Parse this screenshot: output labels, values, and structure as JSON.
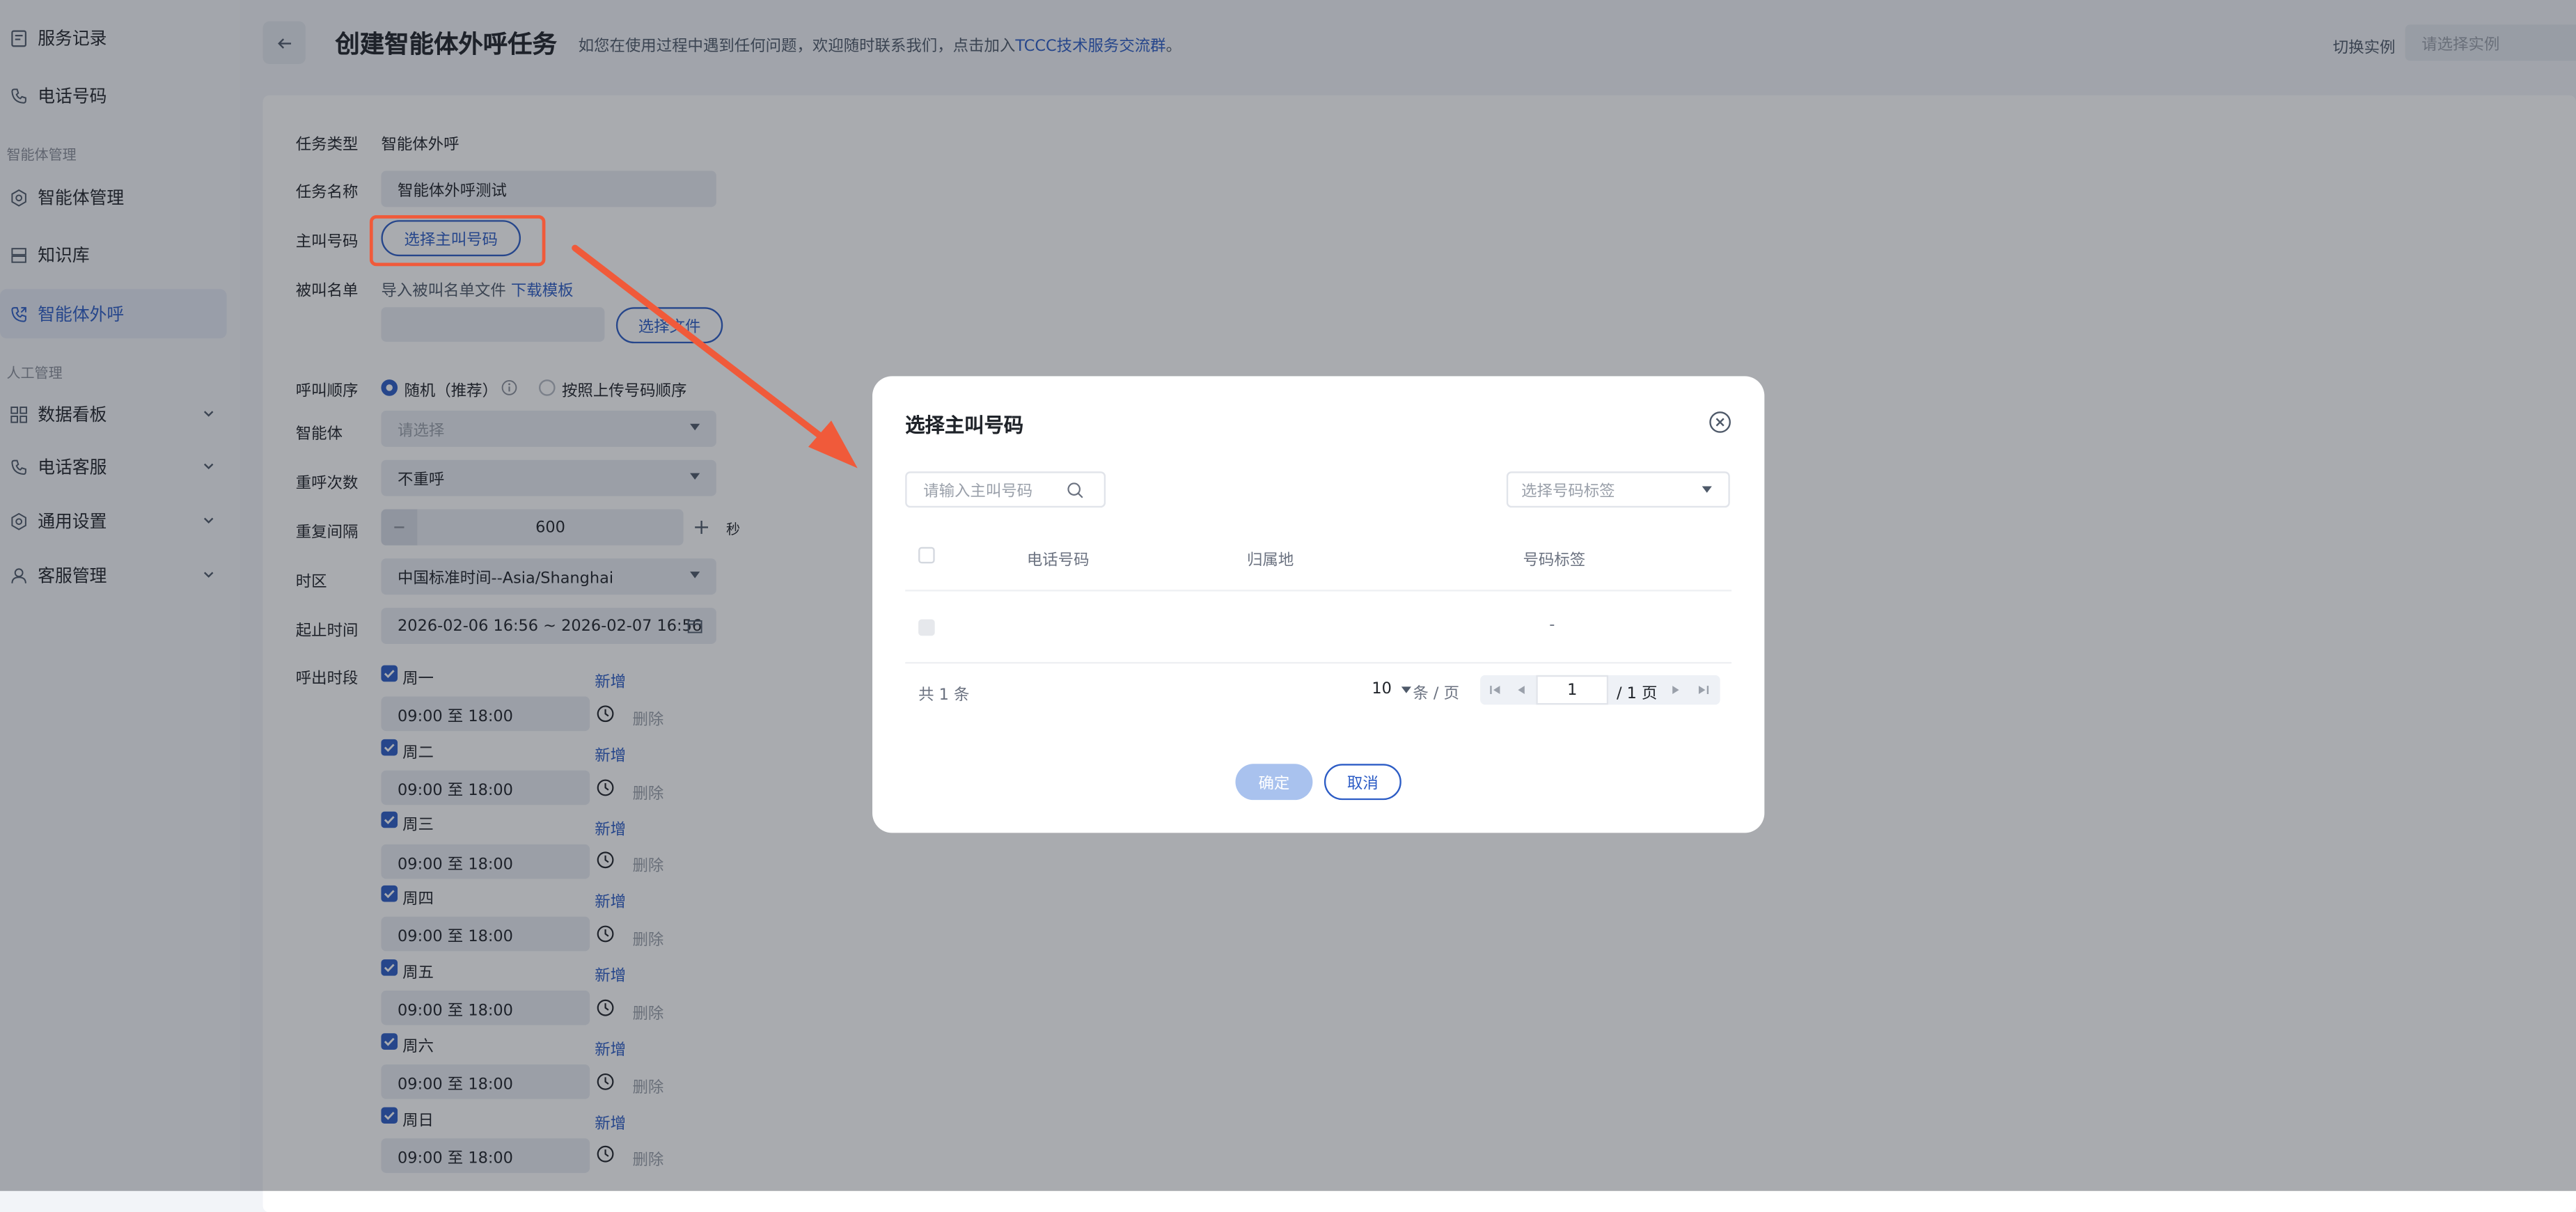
{
  "sidebar": {
    "items_top": [
      {
        "label": "服务记录",
        "icon": "document-icon"
      },
      {
        "label": "电话号码",
        "icon": "phone-icon"
      }
    ],
    "section_agents": "智能体管理",
    "items_agents": [
      {
        "label": "智能体管理",
        "icon": "gear-icon"
      },
      {
        "label": "知识库",
        "icon": "database-icon"
      },
      {
        "label": "智能体外呼",
        "icon": "phone-outbound-icon",
        "active": true
      }
    ],
    "section_human": "人工管理",
    "items_human": [
      {
        "label": "数据看板",
        "icon": "grid-icon"
      },
      {
        "label": "电话客服",
        "icon": "phone-icon"
      },
      {
        "label": "通用设置",
        "icon": "gear-icon"
      },
      {
        "label": "客服管理",
        "icon": "user-icon"
      }
    ]
  },
  "header": {
    "title": "创建智能体外呼任务",
    "desc_prefix": "如您在使用过程中遇到任何问题，欢迎随时联系我们，点击加入",
    "desc_link": "TCCC技术服务交流群",
    "desc_suffix": "。",
    "switch_label": "切换实例",
    "switch_placeholder": "请选择实例"
  },
  "form": {
    "task_type_label": "任务类型",
    "task_type_value": "智能体外呼",
    "task_name_label": "任务名称",
    "task_name_value": "智能体外呼测试",
    "caller_label": "主叫号码",
    "caller_button": "选择主叫号码",
    "callee_label": "被叫名单",
    "callee_hint": "导入被叫名单文件",
    "callee_template_link": "下载模板",
    "callee_file_button": "选择文件",
    "order_label": "呼叫顺序",
    "order_option1": "随机（推荐）",
    "order_option2": "按照上传号码顺序",
    "agent_label": "智能体",
    "agent_placeholder": "请选择",
    "retry_label": "重呼次数",
    "retry_value": "不重呼",
    "interval_label": "重复间隔",
    "interval_value": "600",
    "interval_unit": "秒",
    "timezone_label": "时区",
    "timezone_value": "中国标准时间--Asia/Shanghai",
    "period_label": "起止时间",
    "period_value": "2026-02-06 16:56  ~ 2026-02-07 16:56",
    "slots_label": "呼出时段",
    "add_label": "新增",
    "delete_label": "删除",
    "days": [
      {
        "day": "周一",
        "time": "09:00 至 18:00"
      },
      {
        "day": "周二",
        "time": "09:00 至 18:00"
      },
      {
        "day": "周三",
        "time": "09:00 至 18:00"
      },
      {
        "day": "周四",
        "time": "09:00 至 18:00"
      },
      {
        "day": "周五",
        "time": "09:00 至 18:00"
      },
      {
        "day": "周六",
        "time": "09:00 至 18:00"
      },
      {
        "day": "周日",
        "time": "09:00 至 18:00"
      }
    ]
  },
  "modal": {
    "title": "选择主叫号码",
    "search_placeholder": "请输入主叫号码",
    "tag_placeholder": "选择号码标签",
    "columns": [
      "电话号码",
      "归属地",
      "号码标签"
    ],
    "row_tag": "-",
    "total": "共 1 条",
    "page_size": "10",
    "page_size_unit": "条 / 页",
    "page_current": "1",
    "page_total": "/ 1 页",
    "confirm": "确定",
    "cancel": "取消"
  },
  "colors": {
    "accent": "#2c5cc5",
    "annotation": "#f05a3a"
  }
}
